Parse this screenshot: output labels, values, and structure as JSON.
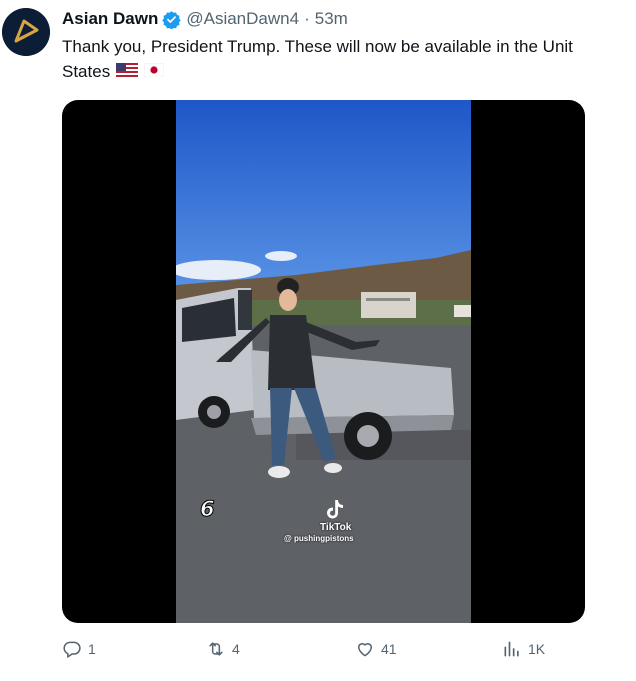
{
  "tweet": {
    "author_name": "Asian Dawn",
    "author_handle": "@AsianDawn4",
    "time_ago": "53m",
    "separator": "·",
    "text_line1": "Thank you, President Trump. These will now be available in the Unit",
    "text_line2": "States",
    "flags": [
      "us-flag-emoji",
      "japan-flag-emoji"
    ]
  },
  "media": {
    "countdown": "6",
    "watermark_app": "TikTok",
    "watermark_handle": "@ pushingpistons"
  },
  "actions": {
    "replies": "1",
    "reposts": "4",
    "likes": "41",
    "views": "1K"
  },
  "colors": {
    "text": "#0f1419",
    "muted": "#536471",
    "verified": "#1d9bf0",
    "avatar_bg": "#0c1d36",
    "logo_gold": "#d9a441"
  }
}
